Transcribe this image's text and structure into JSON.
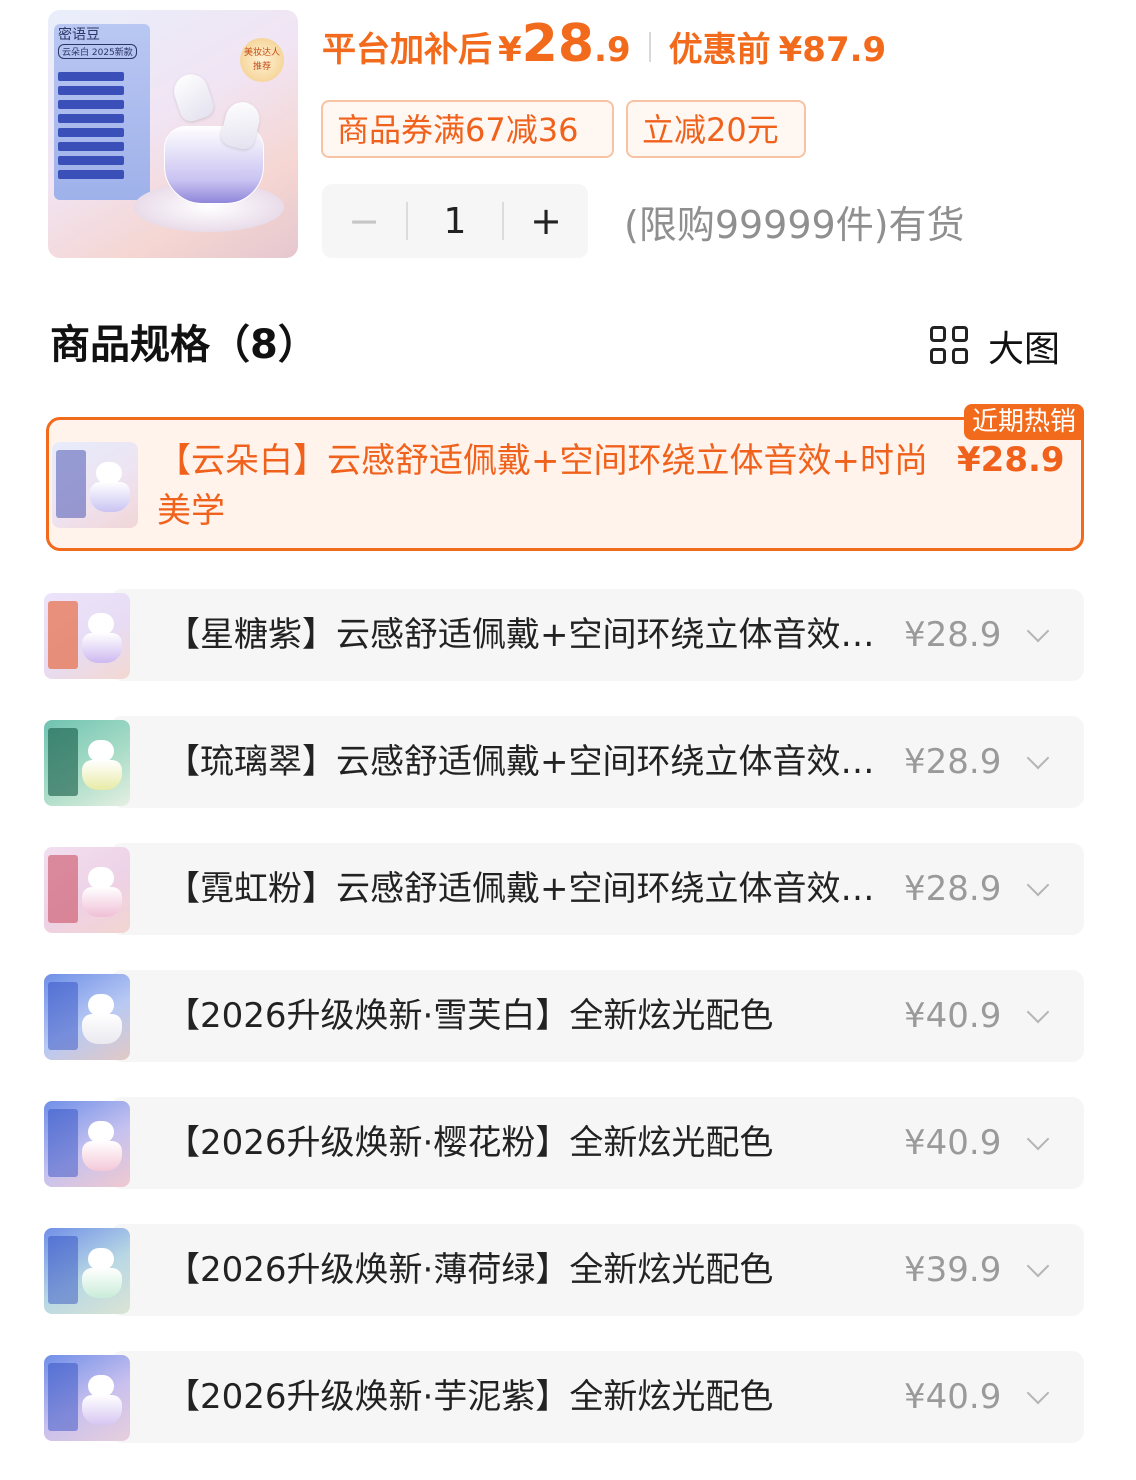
{
  "product": {
    "thumb_brand": "密语豆",
    "thumb_tag": "云朵白 2025新款",
    "thumb_badge": "美妆达人推荐",
    "price_label": "平台加补后",
    "price_currency": "¥",
    "price_int": "28",
    "price_dec": ".9",
    "original_label": "优惠前",
    "original_currency": "¥",
    "original_value": "87.9",
    "accent_color": "#f26a1b"
  },
  "coupons": [
    "商品券满67减36",
    "立减20元"
  ],
  "quantity": {
    "minus": "−",
    "value": "1",
    "plus": "+",
    "stock_text": "(限购99999件)有货"
  },
  "spec": {
    "title": "商品规格（8）",
    "big_view_label": "大图",
    "big_view_icon": "grid-icon"
  },
  "options": [
    {
      "label": "【云朵白】云感舒适佩戴+空间环绕立体音效+时尚美学",
      "price": "¥28.9",
      "badge": "近期热销",
      "selected": true
    },
    {
      "label": "【星糖紫】云感舒适佩戴+空间环绕立体音效+时尚美学",
      "price": "¥28.9"
    },
    {
      "label": "【琉璃翠】云感舒适佩戴+空间环绕立体音效+时尚美学",
      "price": "¥28.9"
    },
    {
      "label": "【霓虹粉】云感舒适佩戴+空间环绕立体音效+时尚美学",
      "price": "¥28.9"
    },
    {
      "label": "【2026升级焕新·雪芙白】全新炫光配色",
      "price": "¥40.9"
    },
    {
      "label": "【2026升级焕新·樱花粉】全新炫光配色",
      "price": "¥40.9"
    },
    {
      "label": "【2026升级焕新·薄荷绿】全新炫光配色",
      "price": "¥39.9"
    },
    {
      "label": "【2026升级焕新·芋泥紫】全新炫光配色",
      "price": "¥40.9"
    }
  ]
}
